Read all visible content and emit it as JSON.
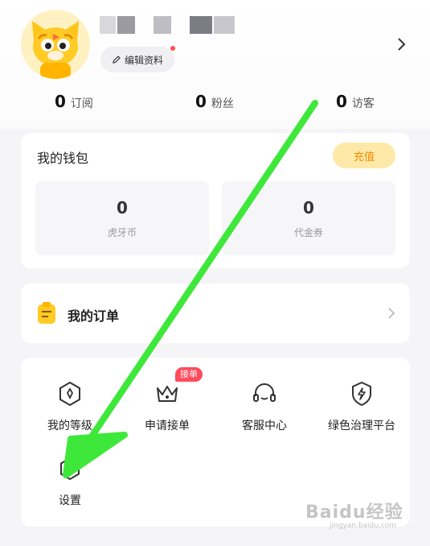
{
  "profile": {
    "edit_label": "编辑资料"
  },
  "stats": [
    {
      "value": "0",
      "label": "订阅"
    },
    {
      "value": "0",
      "label": "粉丝"
    },
    {
      "value": "0",
      "label": "访客"
    }
  ],
  "wallet": {
    "title": "我的钱包",
    "recharge_label": "充值",
    "balances": [
      {
        "value": "0",
        "label": "虎牙币"
      },
      {
        "value": "0",
        "label": "代金券"
      }
    ]
  },
  "orders": {
    "label": "我的订单"
  },
  "services": {
    "items": [
      {
        "label": "我的等级",
        "icon": "level-badge-icon"
      },
      {
        "label": "申请接单",
        "icon": "crown-icon"
      },
      {
        "label": "客服中心",
        "icon": "headset-icon"
      },
      {
        "label": "绿色治理平台",
        "icon": "shield-lightning-icon"
      },
      {
        "label": "设置",
        "icon": "settings-hexagon-icon"
      }
    ],
    "apply_badge": "接单"
  },
  "watermark": {
    "text": "Baidu经验",
    "url": "jingyan.baidu.com"
  },
  "colors": {
    "accent_yellow": "#ffe9a8",
    "recharge_text": "#f08a00",
    "badge_red": "#ff4b5c",
    "annotation_green": "#3ee83a"
  }
}
